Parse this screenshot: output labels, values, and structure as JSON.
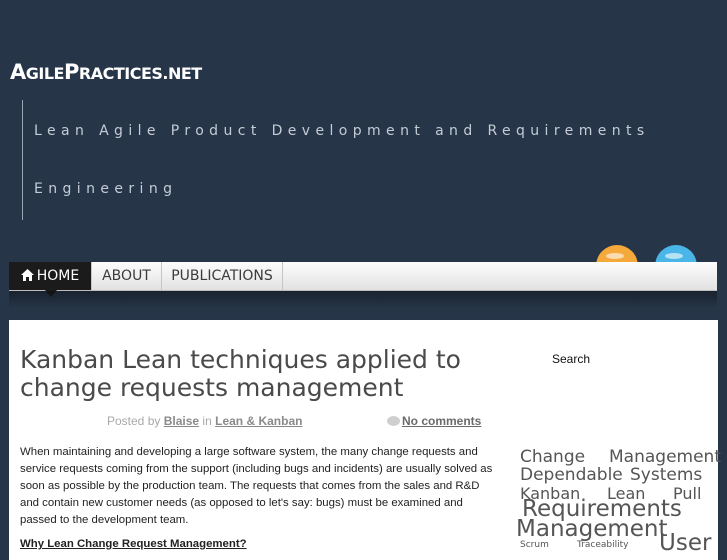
{
  "site": {
    "title_prefix_big_a": "A",
    "title_prefix_small_a": "GILE",
    "title_prefix_big_p": "P",
    "title_prefix_small_p": "RACTICES.NET",
    "tagline_line1": "Lean Agile Product Development and Requirements",
    "tagline_line2": "Engineering"
  },
  "nav": {
    "home": "HOME",
    "about": "ABOUT",
    "publications": "PUBLICATIONS"
  },
  "post": {
    "title": "Kanban Lean techniques applied to change requests management",
    "posted_by": "Posted by",
    "author": "Blaise",
    "in_word": "in",
    "category": "Lean & Kanban",
    "comments": "No comments",
    "body": "When maintaining and developing a large software system, the many change requests and service requests coming from the support (including bugs and incidents) are usually solved as soon as possible by the production team. The requests that comes from the sales and R&D and contain new customer needs (as opposed to let's say: bugs) must be examined and passed to the development team.",
    "subhead": "Why Lean Change Request Management?"
  },
  "sidebar": {
    "search_label": "Search",
    "tags": [
      "Change",
      "Management",
      "Dependable",
      "Systems",
      "Kanban",
      "Lean",
      "Pull",
      "Requirements",
      "Management",
      "Scrum",
      "Traceability",
      "User"
    ]
  },
  "colors": {
    "header_bg": "#263548",
    "nav_active_bg": "#1b1b1b",
    "rss": "#f6a93b",
    "twitter": "#4ab6e8"
  },
  "icons": {
    "home": "home-icon",
    "rss": "rss-icon",
    "twitter": "twitter-icon",
    "comment": "comment-bubble-icon"
  }
}
